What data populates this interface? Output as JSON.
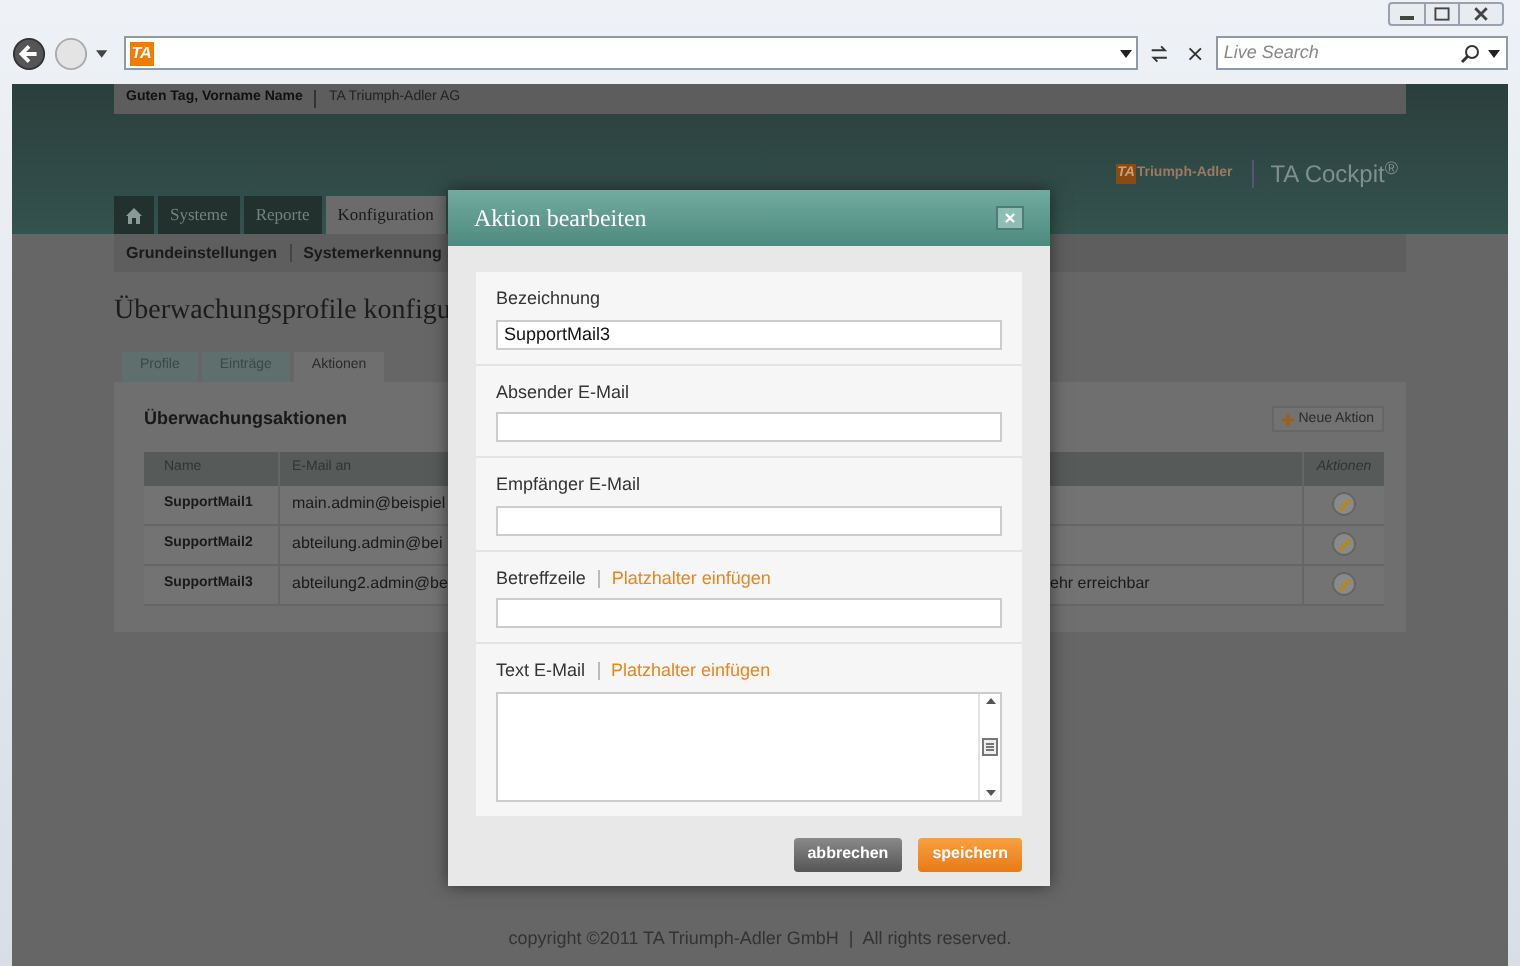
{
  "browser": {
    "address_logo": "TA",
    "search_placeholder": "Live Search"
  },
  "header": {
    "greeting": "Guten Tag, Vorname Name",
    "company": "TA Triumph-Adler AG",
    "logo_mark": "TA",
    "logo_name": "Triumph-Adler",
    "product": "TA Cockpit$^{®}$"
  },
  "nav_tabs": [
    {
      "kind": "home",
      "selected": false
    },
    {
      "kind": "text",
      "label": "Systeme",
      "selected": false
    },
    {
      "kind": "text",
      "label": "Reporte",
      "selected": false
    },
    {
      "kind": "text",
      "label": "Konfiguration",
      "selected": true
    }
  ],
  "subnav": [
    "Grundeinstellungen",
    "Systemerkennung"
  ],
  "heading": "Überwachungsprofile konfigu",
  "tabs": [
    {
      "label": "Profile",
      "selected": false
    },
    {
      "label": "Einträge",
      "selected": false
    },
    {
      "label": "Aktionen",
      "selected": true
    }
  ],
  "panel": {
    "title": "Überwachungsaktionen",
    "new_button": "Neue Aktion",
    "columns": [
      "Name",
      "E-Mail an",
      "Aktionen"
    ],
    "rows": [
      {
        "name": "SupportMail1",
        "email": "main.admin@beispiel"
      },
      {
        "name": "SupportMail2",
        "email": "abteilung.admin@bei"
      },
      {
        "name": "SupportMail3",
        "email": "abteilung2.admin@be",
        "column_3": "ehr erreichbar"
      }
    ]
  },
  "footer": "copyright ©2011 TA Triumph-Adler GmbH  |  All rights reserved.",
  "dialog": {
    "title": "Aktion bearbeiten",
    "fields": [
      {
        "kind": "input",
        "label": "Bezeichnung",
        "value": "SupportMail3"
      },
      {
        "kind": "input",
        "label": "Absender E-Mail"
      },
      {
        "kind": "input",
        "label": "Empfänger E-Mail"
      },
      {
        "kind": "input",
        "label": "Betreffzeile",
        "link": "Platzhalter einfügen"
      },
      {
        "kind": "textarea",
        "label": "Text E-Mail",
        "link": "Platzhalter einfügen"
      }
    ],
    "buttons": [
      {
        "kind": "secondary",
        "label": "abbrechen"
      },
      {
        "kind": "primary",
        "label": "speichern"
      }
    ]
  }
}
